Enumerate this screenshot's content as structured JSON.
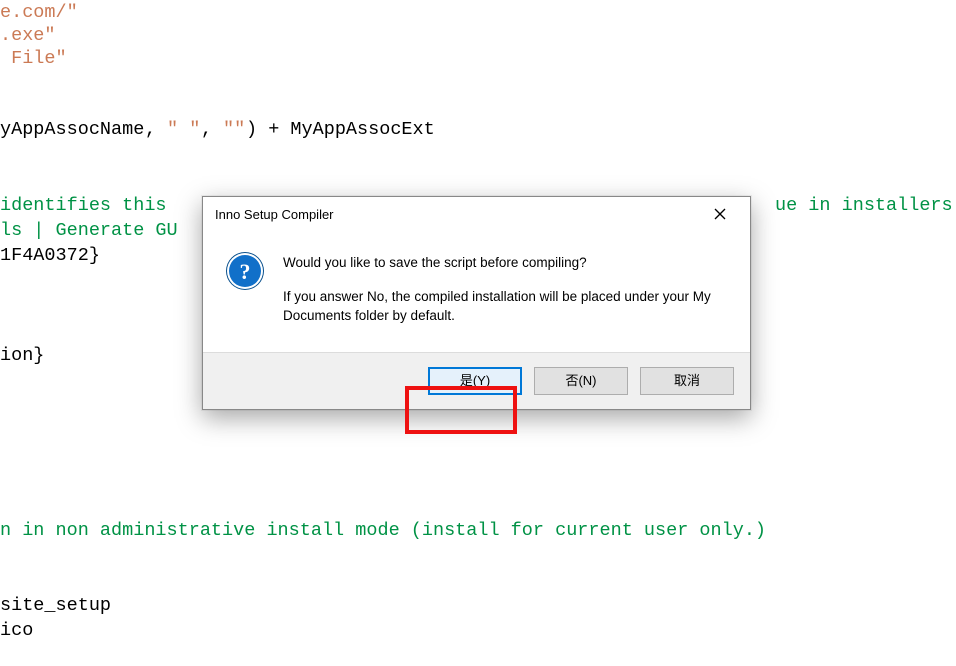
{
  "code": {
    "l1": "e.com/\"",
    "l2": ".exe\"",
    "l3": " File\"",
    "l4a": "yAppAssocName",
    "l4b": ", ",
    "l4c": "\" \"",
    "l4d": ", ",
    "l4e": "\"\"",
    "l4f": ") + MyAppAssocExt",
    "l5a": "identifies this ",
    "l5b": "ue in installers",
    "l6": "ls | Generate GU",
    "l7": "1F4A0372}",
    "l8": "ion}",
    "l9": "n in non administrative install mode (install for current user only.)",
    "l10": "site_setup",
    "l11": "ico"
  },
  "dialog": {
    "title": "Inno Setup Compiler",
    "question": "Would you like to save the script before compiling?",
    "detail": "If you answer No, the compiled installation will be placed under your My Documents folder by default.",
    "buttons": {
      "yes": "是(Y)",
      "no": "否(N)",
      "cancel": "取消"
    }
  }
}
